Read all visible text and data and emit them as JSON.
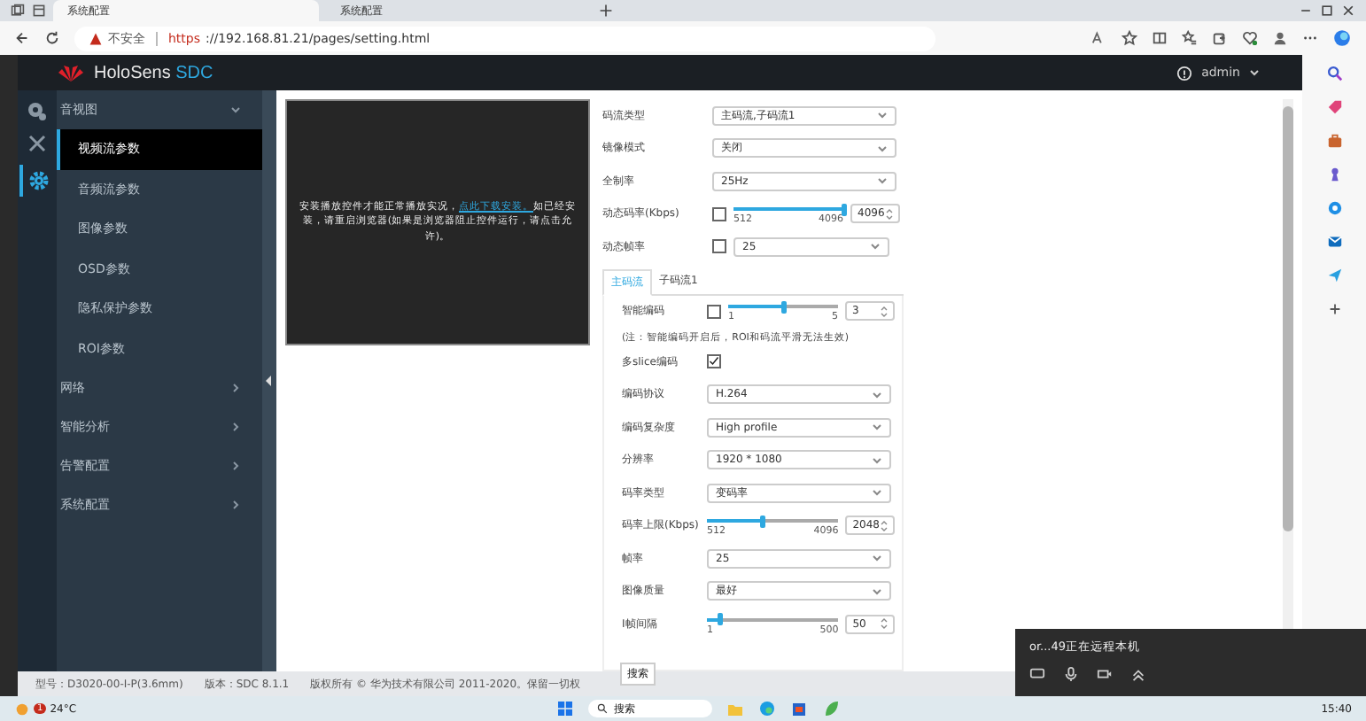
{
  "browser": {
    "tabs": [
      {
        "title": "系统配置",
        "selected": true
      },
      {
        "title": "系统配置",
        "selected": false
      }
    ],
    "address": {
      "warning": "不安全",
      "scheme": "https",
      "rest": "://192.168.81.21/pages/setting.html"
    }
  },
  "app": {
    "brand": "HoloSens",
    "brand_accent": "SDC",
    "user": "admin",
    "menu": [
      {
        "label": "音视图",
        "expanded": true,
        "children": [
          {
            "label": "视频流参数",
            "selected": true
          },
          {
            "label": "音频流参数",
            "selected": false
          },
          {
            "label": "图像参数",
            "selected": false
          },
          {
            "label": "OSD参数",
            "selected": false
          },
          {
            "label": "隐私保护参数",
            "selected": false
          },
          {
            "label": "ROI参数",
            "selected": false
          }
        ]
      },
      {
        "label": "网络",
        "expanded": false
      },
      {
        "label": "智能分析",
        "expanded": false
      },
      {
        "label": "告警配置",
        "expanded": false
      },
      {
        "label": "系统配置",
        "expanded": false
      }
    ],
    "video": {
      "message_before": "安装播放控件才能正常播放实况，",
      "link": "点此下载安装。",
      "message_after": "如已经安装，请重启浏览器(如果是浏览器阻止控件运行，请点击允许)。"
    },
    "form": [
      {
        "kind": "select",
        "label": "码流类型",
        "value": "主码流,子码流1"
      },
      {
        "kind": "select",
        "label": "镜像模式",
        "value": "关闭"
      },
      {
        "kind": "select",
        "label": "全制率",
        "value": "25Hz"
      },
      {
        "kind": "check_slider",
        "label": "动态码率(Kbps)",
        "checked": false,
        "level": 1,
        "min": "512",
        "max": "4096",
        "value": "4096"
      },
      {
        "kind": "check_select",
        "label": "动态帧率",
        "checked": false,
        "value": "25"
      }
    ],
    "stream_tabs": [
      {
        "label": "主码流",
        "selected": true
      },
      {
        "label": "子码流1",
        "selected": false
      }
    ],
    "stream_form": [
      {
        "kind": "check_slider",
        "label": "智能编码",
        "checked": false,
        "level": 0.5,
        "min": "1",
        "max": "5",
        "value": "3"
      },
      {
        "kind": "note",
        "text": "(注：智能编码开启后，ROI和码流平滑无法生效)"
      },
      {
        "kind": "checkbox",
        "label": "多slice编码",
        "checked": true
      },
      {
        "kind": "select",
        "label": "编码协议",
        "value": "H.264"
      },
      {
        "kind": "select",
        "label": "编码复杂度",
        "value": "High profile"
      },
      {
        "kind": "select",
        "label": "分辨率",
        "value": "1920 * 1080"
      },
      {
        "kind": "select",
        "label": "码率类型",
        "value": "变码率"
      },
      {
        "kind": "slider",
        "label": "码率上限(Kbps)",
        "level": 0.43,
        "min": "512",
        "max": "4096",
        "value": "2048"
      },
      {
        "kind": "select",
        "label": "帧率",
        "value": "25"
      },
      {
        "kind": "select",
        "label": "图像质量",
        "value": "最好"
      },
      {
        "kind": "slider",
        "label": "I帧间隔",
        "level": 0.1,
        "min": "1",
        "max": "500",
        "value": "50"
      }
    ],
    "footer": {
      "model": "型号：D3020-00-I-P(3.6mm)",
      "version": "版本：SDC 8.1.1",
      "copyright": "版权所有 © 华为技术有限公司 2011-2020。保留一切权"
    },
    "tooltip": "搜索"
  },
  "notification": {
    "text": "or...49正在远程本机"
  },
  "taskbar": {
    "weather_badge": "1",
    "temperature": "24°C",
    "search": "搜索",
    "time": "15:40"
  }
}
